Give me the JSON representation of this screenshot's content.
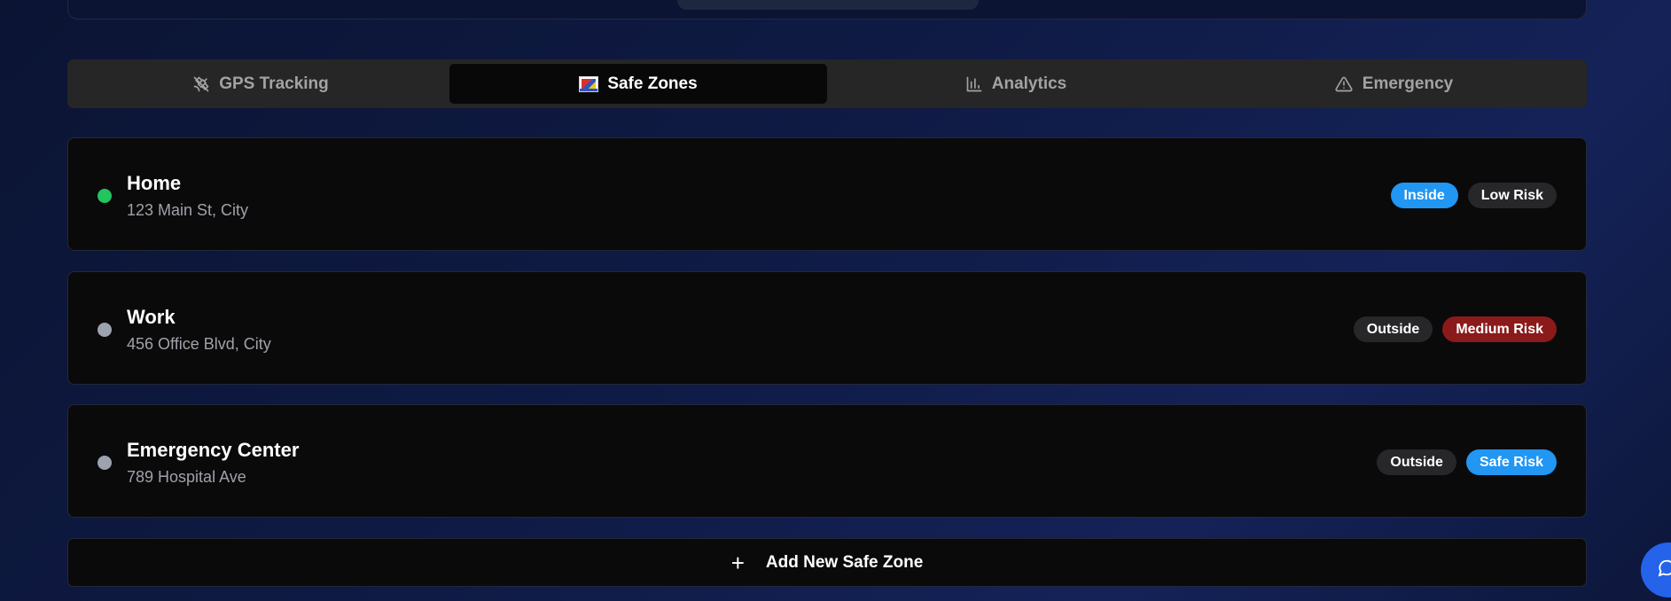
{
  "tabs": [
    {
      "label": "GPS Tracking",
      "icon": "satellite-off-icon",
      "active": false
    },
    {
      "label": "Safe Zones",
      "icon": "flag-image-icon",
      "active": true
    },
    {
      "label": "Analytics",
      "icon": "bar-chart-icon",
      "active": false
    },
    {
      "label": "Emergency",
      "icon": "warning-triangle-icon",
      "active": false
    }
  ],
  "zones": [
    {
      "name": "Home",
      "address": "123 Main St, City",
      "status_color": "#22c55e",
      "badges": [
        {
          "label": "Inside",
          "color": "#2196f3"
        },
        {
          "label": "Low Risk",
          "color": "#27272a"
        }
      ]
    },
    {
      "name": "Work",
      "address": "456 Office Blvd, City",
      "status_color": "#9ca3af",
      "badges": [
        {
          "label": "Outside",
          "color": "#27272a"
        },
        {
          "label": "Medium Risk",
          "color": "#8b1a1a"
        }
      ]
    },
    {
      "name": "Emergency Center",
      "address": "789 Hospital Ave",
      "status_color": "#9ca3af",
      "badges": [
        {
          "label": "Outside",
          "color": "#27272a"
        },
        {
          "label": "Safe Risk",
          "color": "#2196f3"
        }
      ]
    }
  ],
  "add_button": {
    "label": "Add New Safe Zone",
    "icon": "plus-icon"
  },
  "chat": {
    "icon": "chat-bubble-icon"
  },
  "colors": {
    "accent": "#2563eb",
    "card_bg": "#0a0a0b",
    "tab_bar_bg": "#262626"
  }
}
